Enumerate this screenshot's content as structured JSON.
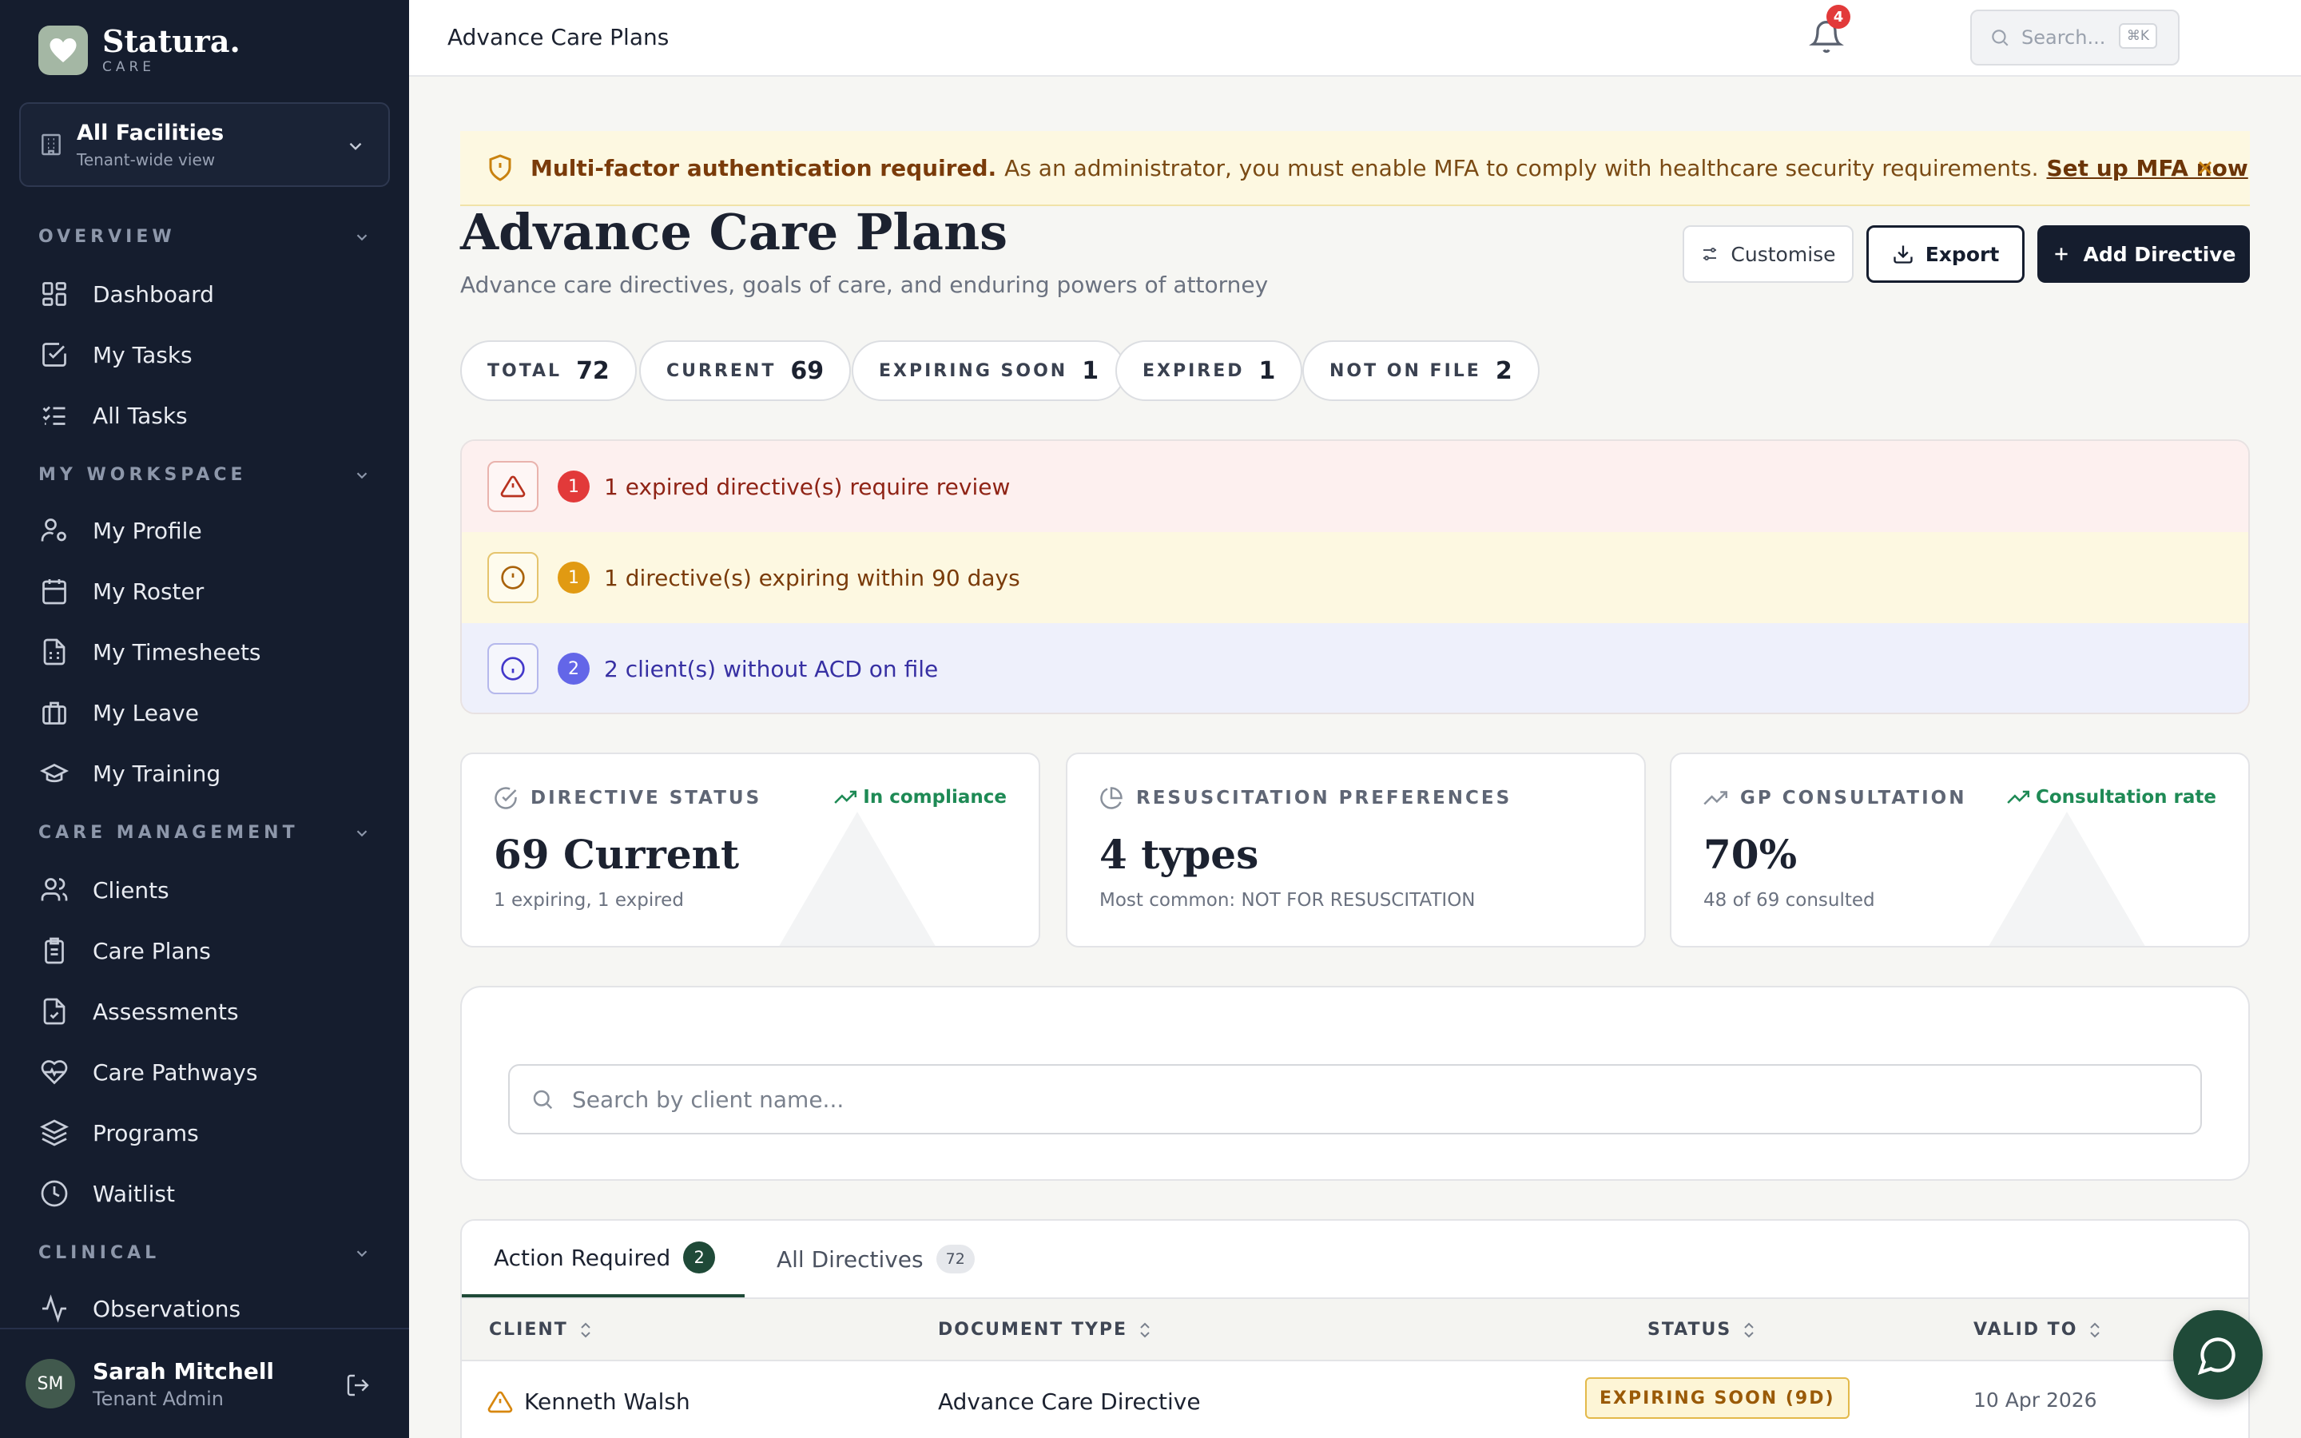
{
  "brand": {
    "name": "Statura.",
    "sub": "CARE"
  },
  "facility": {
    "name": "All Facilities",
    "sub": "Tenant-wide view"
  },
  "sidebar": {
    "sections": [
      {
        "title": "OVERVIEW",
        "items": [
          "Dashboard",
          "My Tasks",
          "All Tasks"
        ]
      },
      {
        "title": "MY WORKSPACE",
        "items": [
          "My Profile",
          "My Roster",
          "My Timesheets",
          "My Leave",
          "My Training"
        ]
      },
      {
        "title": "CARE MANAGEMENT",
        "items": [
          "Clients",
          "Care Plans",
          "Assessments",
          "Care Pathways",
          "Programs",
          "Waitlist"
        ]
      },
      {
        "title": "CLINICAL",
        "items": [
          "Observations"
        ]
      }
    ]
  },
  "user": {
    "initials": "SM",
    "name": "Sarah Mitchell",
    "role": "Tenant Admin"
  },
  "topbar": {
    "breadcrumb": "Advance Care Plans",
    "search_placeholder": "Search...",
    "search_kbd": "⌘K",
    "notifications": "4"
  },
  "mfa": {
    "title": "Multi-factor authentication required.",
    "text": "As an administrator, you must enable MFA to comply with healthcare security requirements.",
    "link": "Set up MFA now"
  },
  "page": {
    "title": "Advance Care Plans",
    "subtitle": "Advance care directives, goals of care, and enduring powers of attorney"
  },
  "actions": {
    "customise": "Customise",
    "export": "Export",
    "add": "Add Directive"
  },
  "stats": [
    {
      "label": "TOTAL",
      "value": "72"
    },
    {
      "label": "CURRENT",
      "value": "69"
    },
    {
      "label": "EXPIRING SOON",
      "value": "1"
    },
    {
      "label": "EXPIRED",
      "value": "1"
    },
    {
      "label": "NOT ON FILE",
      "value": "2"
    }
  ],
  "alerts": [
    {
      "count": "1",
      "text": "1 expired directive(s) require review",
      "bg": "#fdf0ef",
      "color": "#8f2416",
      "badge": "#e23a3a",
      "border": "#e9b3ad"
    },
    {
      "count": "1",
      "text": "1 directive(s) expiring within 90 days",
      "bg": "#fdf8e1",
      "color": "#7a3b0a",
      "badge": "#e19a12",
      "border": "#e5c46d"
    },
    {
      "count": "2",
      "text": "2 client(s) without ACD on file",
      "bg": "#eef0fb",
      "color": "#3730a3",
      "badge": "#6366e8",
      "border": "#b5b8ec"
    }
  ],
  "cards": [
    {
      "label": "DIRECTIVE STATUS",
      "trend": "In compliance",
      "big": "69 Current",
      "small": "1 expiring, 1 expired"
    },
    {
      "label": "RESUSCITATION PREFERENCES",
      "trend": "",
      "big": "4 types",
      "small": "Most common: NOT FOR RESUSCITATION"
    },
    {
      "label": "GP CONSULTATION",
      "trend": "Consultation rate",
      "big": "70%",
      "small": "48 of 69 consulted"
    }
  ],
  "search": {
    "placeholder": "Search by client name..."
  },
  "tabs": [
    {
      "label": "Action Required",
      "count": "2"
    },
    {
      "label": "All Directives",
      "count": "72"
    }
  ],
  "table": {
    "columns": [
      "CLIENT",
      "DOCUMENT TYPE",
      "STATUS",
      "VALID TO"
    ],
    "rows": [
      {
        "client": "Kenneth Walsh",
        "doc_type": "Advance Care Directive",
        "status": "EXPIRING SOON (9D)",
        "valid_to": "10 Apr 2026"
      }
    ]
  }
}
